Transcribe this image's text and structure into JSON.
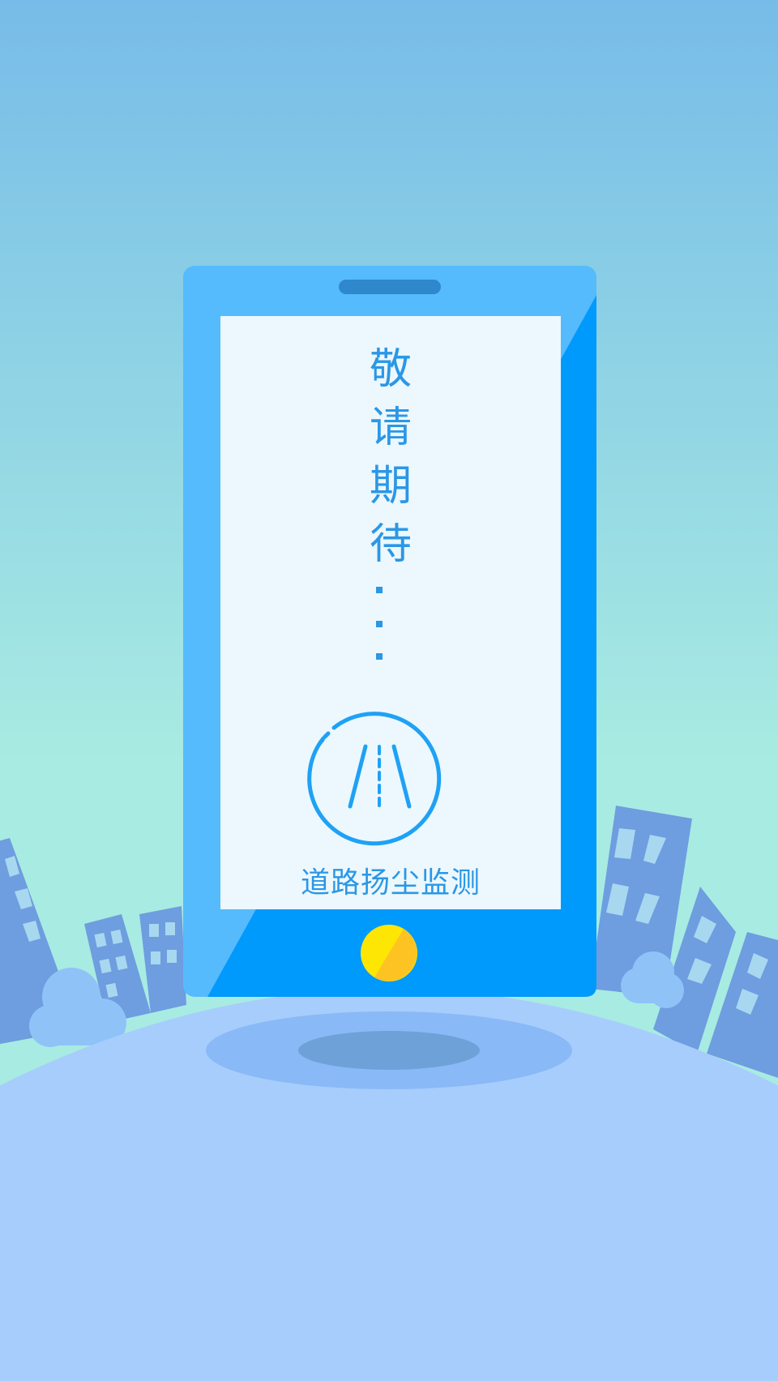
{
  "screen": {
    "title_chars": [
      "敬",
      "请",
      "期",
      "待"
    ],
    "caption": "道路扬尘监测"
  },
  "icons": {
    "road": "road-icon",
    "home_button": "home-button-icon",
    "speaker": "speaker-slot"
  },
  "colors": {
    "sky_top": "#77bce8",
    "sky_bottom": "#a8ebe2",
    "hill": "#a7cdfc",
    "phone_body": "#55bbfc",
    "phone_accent": "#0099fc",
    "screen": "#ecf8fd",
    "text": "#2b97e6",
    "building": "#6e9de0",
    "home_button": "#fdc323"
  }
}
